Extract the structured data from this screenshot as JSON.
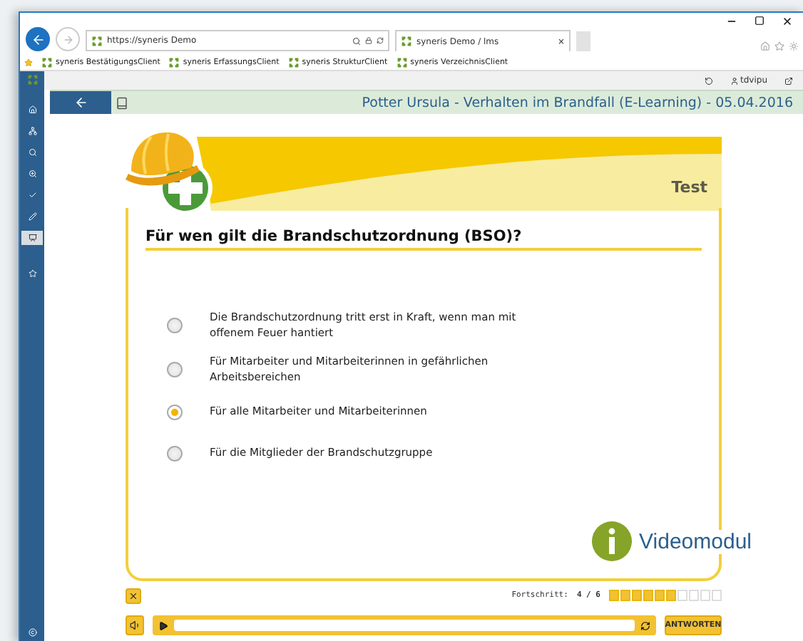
{
  "browser": {
    "address": "https://syneris Demo",
    "tab_title": "syneris Demo / lms",
    "tab_close": "×",
    "favorites": [
      "syneris BestätigungsClient",
      "syneris ErfassungsClient",
      "syneris StrukturClient",
      "syneris VerzeichnisClient"
    ]
  },
  "app": {
    "user": "tdvipu",
    "header_title": "Potter Ursula - Verhalten im Brandfall (E-Learning) - 05.04.2016"
  },
  "sidebar": {
    "items": [
      {
        "kind": "home",
        "selected": false
      },
      {
        "kind": "sitemap",
        "selected": false
      },
      {
        "kind": "search",
        "selected": false
      },
      {
        "kind": "zoom",
        "selected": false
      },
      {
        "kind": "check",
        "selected": false
      },
      {
        "kind": "pencil",
        "selected": false
      },
      {
        "kind": "course",
        "selected": true
      },
      {
        "kind": "star",
        "selected": false
      }
    ]
  },
  "lesson": {
    "section_label": "Test",
    "question": "Für wen gilt die Brandschutzordnung (BSO)?",
    "answers": [
      {
        "text": "Die Brandschutzordnung tritt erst in Kraft, wenn man mit offenem Feuer hantiert",
        "selected": false
      },
      {
        "text": "Für Mitarbeiter und Mitarbeiterinnen in gefährlichen Arbeitsbereichen",
        "selected": false
      },
      {
        "text": "Für alle Mitarbeiter und Mitarbeiterinnen",
        "selected": true
      },
      {
        "text": "Für die Mitglieder der Brandschutzgruppe",
        "selected": false
      }
    ],
    "badge": "Videomodul",
    "progress_label": "Fortschritt:",
    "progress_value": "4 / 6",
    "progress": {
      "level": 0.6
    },
    "submit_button": "ANTWORTEN"
  }
}
